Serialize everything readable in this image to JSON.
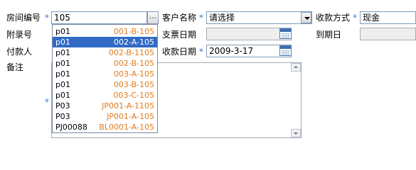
{
  "form": {
    "room_no": {
      "label": "房间编号",
      "value": "105"
    },
    "customer": {
      "label": "客户名称",
      "value": "请选择"
    },
    "pay_method": {
      "label": "收款方式",
      "value": "现金"
    },
    "attach_no": {
      "label": "附录号"
    },
    "cheque_date": {
      "label": "支票日期"
    },
    "due_date": {
      "label": "到期日"
    },
    "payer": {
      "label": "付款人"
    },
    "receive_date": {
      "label": "收款日期",
      "value": "2009-3-17"
    },
    "notes": {
      "label": "备注"
    },
    "ellipsis_label": "..."
  },
  "autocomplete": {
    "items": [
      {
        "key": "p01",
        "value": "001-B-105"
      },
      {
        "key": "p01",
        "value": "002-A-105",
        "selected": true
      },
      {
        "key": "p01",
        "value": "002-B-1105"
      },
      {
        "key": "p01",
        "value": "002-B-105"
      },
      {
        "key": "p01",
        "value": "003-A-105"
      },
      {
        "key": "p01",
        "value": "003-B-105"
      },
      {
        "key": "p01",
        "value": "003-C-105"
      },
      {
        "key": "P03",
        "value": "JP001-A-1105"
      },
      {
        "key": "P03",
        "value": "JP001-A-105"
      },
      {
        "key": "PJ00088",
        "value": "BL0001-A-105"
      }
    ]
  },
  "colors": {
    "required": "#3a78c8",
    "highlight": "#316ac5",
    "item_value": "#e07b1f"
  }
}
